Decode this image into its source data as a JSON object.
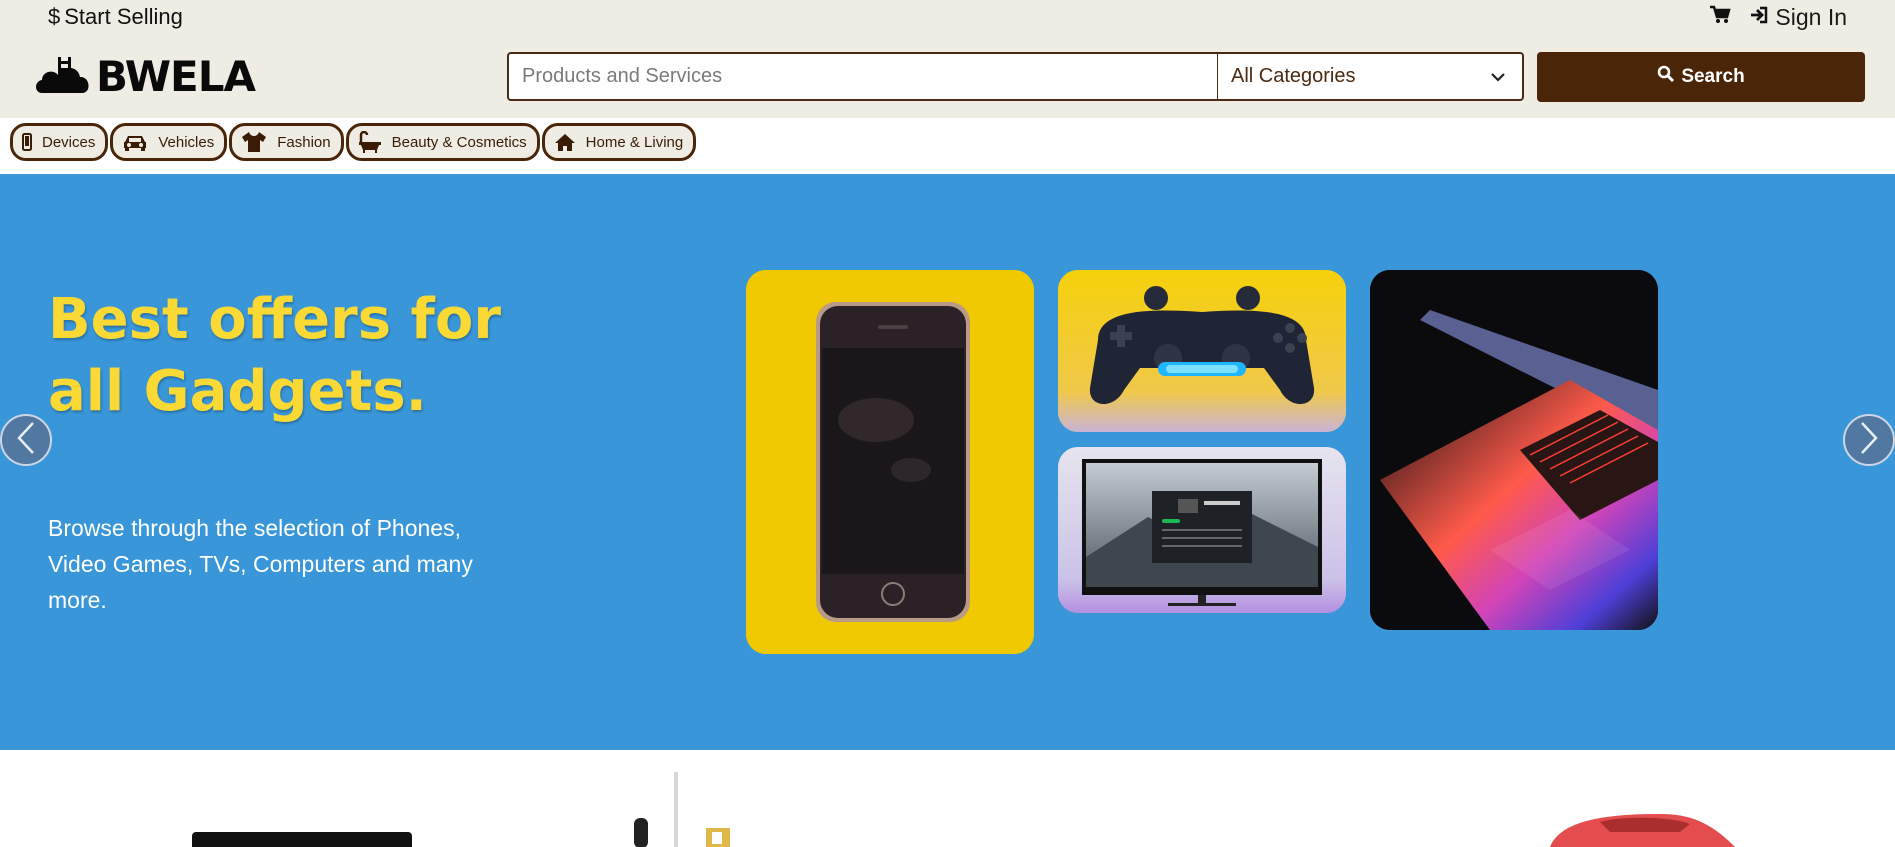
{
  "topbar": {
    "start_selling_label": "Start Selling",
    "sign_in_label": "Sign In"
  },
  "logo": {
    "text": "BWELA"
  },
  "search": {
    "placeholder": "Products and Services",
    "category_selected": "All Categories",
    "button_label": "Search"
  },
  "categories": [
    {
      "label": "Devices",
      "icon": "mobile-phone-icon"
    },
    {
      "label": "Vehicles",
      "icon": "car-icon"
    },
    {
      "label": "Fashion",
      "icon": "t-shirt-icon"
    },
    {
      "label": "Beauty & Cosmetics",
      "icon": "bathtub-icon"
    },
    {
      "label": "Home & Living",
      "icon": "home-icon"
    }
  ],
  "hero": {
    "title": "Best offers for all Gadgets.",
    "subtitle": "Browse through the selection of Phones, Video Games, TVs, Computers and many more."
  },
  "colors": {
    "topbar_bg": "#efede3",
    "brand_brown": "#4a2508",
    "hero_bg": "#3896d9",
    "hero_title": "#fbd934"
  }
}
